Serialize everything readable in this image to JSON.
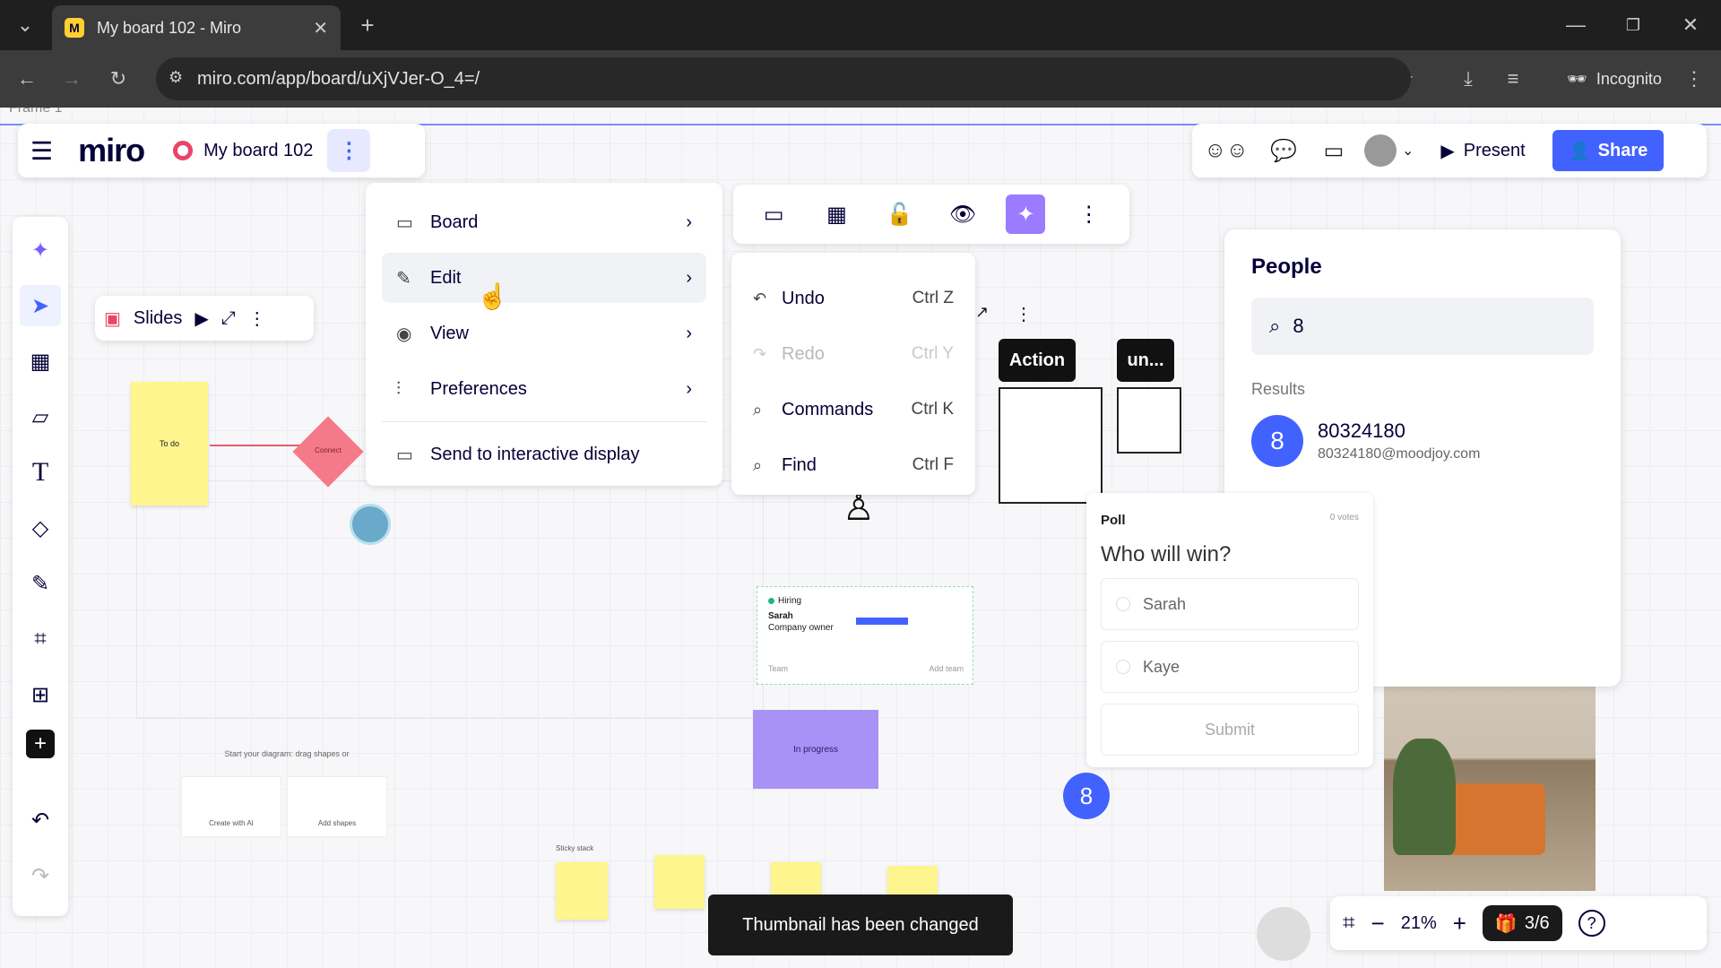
{
  "browser": {
    "tab_title": "My board 102 - Miro",
    "favicon_letter": "M",
    "url": "miro.com/app/board/uXjVJer-O_4=/",
    "incognito_label": "Incognito"
  },
  "board": {
    "frame_label": "Frame 1",
    "logo": "miro",
    "name": "My board 102",
    "present_label": "Present",
    "share_label": "Share"
  },
  "main_menu": {
    "items": [
      {
        "label": "Board",
        "icon": "board-icon",
        "has_submenu": true
      },
      {
        "label": "Edit",
        "icon": "pencil-icon",
        "has_submenu": true,
        "active": true
      },
      {
        "label": "View",
        "icon": "eye-icon",
        "has_submenu": true
      },
      {
        "label": "Preferences",
        "icon": "sliders-icon",
        "has_submenu": true
      },
      {
        "label": "Send to interactive display",
        "icon": "display-icon",
        "has_submenu": false
      }
    ]
  },
  "edit_menu": {
    "items": [
      {
        "label": "Undo",
        "shortcut": "Ctrl Z",
        "disabled": false
      },
      {
        "label": "Redo",
        "shortcut": "Ctrl Y",
        "disabled": true
      },
      {
        "label": "Commands",
        "shortcut": "Ctrl K",
        "disabled": false
      },
      {
        "label": "Find",
        "shortcut": "Ctrl F",
        "disabled": false
      }
    ]
  },
  "slides": {
    "label": "Slides"
  },
  "canvas": {
    "sticky_todo": "To do",
    "diamond_label": "Connect",
    "action_label": "Action",
    "un_label": "un...",
    "hiring_status": "Hiring",
    "hiring_name": "Sarah",
    "hiring_role": "Company owner",
    "hiring_team": "Team",
    "hiring_add": "Add team",
    "inprogress_label": "In progress",
    "diagram_hint": "Start your diagram: drag shapes or",
    "create_ai": "Create with AI",
    "add_shapes": "Add shapes",
    "sticky_stack": "Sticky stack",
    "cursor_badge": "8"
  },
  "people": {
    "title": "People",
    "search_value": "8",
    "results_label": "Results",
    "person_badge": "8",
    "person_name": "80324180",
    "person_email": "80324180@moodjoy.com"
  },
  "poll": {
    "label": "Poll",
    "votes": "0 votes",
    "question": "Who will win?",
    "options": [
      "Sarah",
      "Kaye"
    ],
    "submit_label": "Submit"
  },
  "toast": {
    "message": "Thumbnail has been changed"
  },
  "zoom": {
    "level": "21%",
    "slides_count": "3/6"
  },
  "colors": {
    "accent": "#4262ff",
    "sticky_yellow": "#fff58e",
    "diamond_pink": "#f47a8a",
    "purple_card": "#a892f5"
  }
}
